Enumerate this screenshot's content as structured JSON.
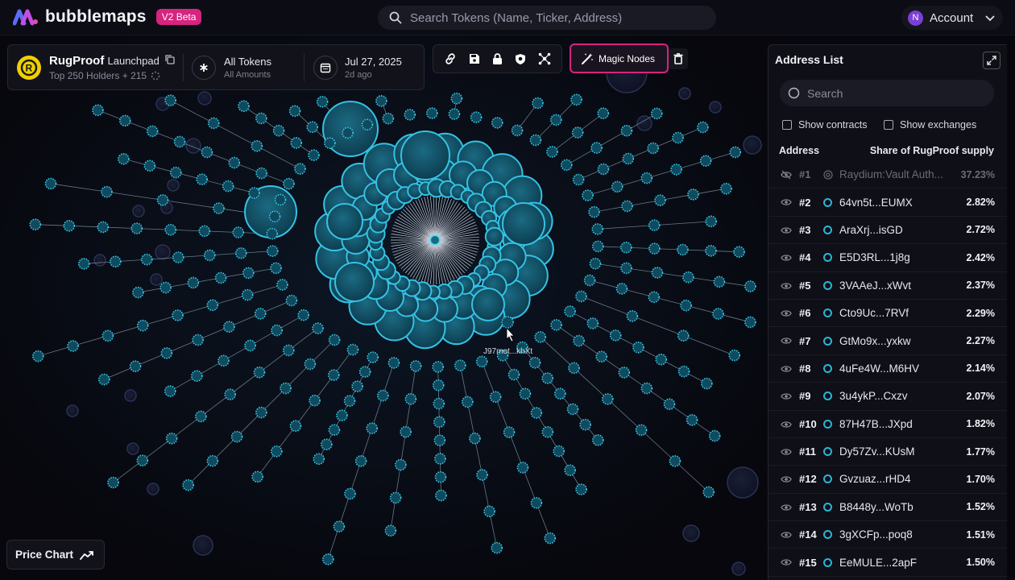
{
  "app": {
    "name": "bubblemaps",
    "badge": "V2 Beta"
  },
  "search": {
    "placeholder": "Search Tokens (Name, Ticker, Address)"
  },
  "account": {
    "initial": "N",
    "label": "Account"
  },
  "token": {
    "name": "RugProof",
    "platform": "Launchpad",
    "holders_text": "Top 250 Holders + 215",
    "filter_title": "All Tokens",
    "filter_sub": "All Amounts",
    "date": "Jul 27, 2025",
    "date_ago": "2d ago"
  },
  "toolbar": {
    "magic_label": "Magic Nodes"
  },
  "graph": {
    "hover_label": "J97mot...khXt"
  },
  "panel": {
    "title": "Address List",
    "search_placeholder": "Search",
    "show_contracts": "Show contracts",
    "show_exchanges": "Show exchanges",
    "col_address": "Address",
    "col_share": "Share of RugProof supply",
    "rows": [
      {
        "rank": "#1",
        "addr": "Raydium:Vault Auth...",
        "pct": "37.23%"
      },
      {
        "rank": "#2",
        "addr": "64vn5t...EUMX",
        "pct": "2.82%"
      },
      {
        "rank": "#3",
        "addr": "AraXrj...isGD",
        "pct": "2.72%"
      },
      {
        "rank": "#4",
        "addr": "E5D3RL...1j8g",
        "pct": "2.42%"
      },
      {
        "rank": "#5",
        "addr": "3VAAeJ...xWvt",
        "pct": "2.37%"
      },
      {
        "rank": "#6",
        "addr": "Cto9Uc...7RVf",
        "pct": "2.29%"
      },
      {
        "rank": "#7",
        "addr": "GtMo9x...yxkw",
        "pct": "2.27%"
      },
      {
        "rank": "#8",
        "addr": "4uFe4W...M6HV",
        "pct": "2.14%"
      },
      {
        "rank": "#9",
        "addr": "3u4ykP...Cxzv",
        "pct": "2.07%"
      },
      {
        "rank": "#10",
        "addr": "87H47B...JXpd",
        "pct": "1.82%"
      },
      {
        "rank": "#11",
        "addr": "Dy57Zv...KUsM",
        "pct": "1.77%"
      },
      {
        "rank": "#12",
        "addr": "Gvzuaz...rHD4",
        "pct": "1.70%"
      },
      {
        "rank": "#13",
        "addr": "B8448y...WoTb",
        "pct": "1.52%"
      },
      {
        "rank": "#14",
        "addr": "3gXCFp...poq8",
        "pct": "1.51%"
      },
      {
        "rank": "#15",
        "addr": "EeMULE...2apF",
        "pct": "1.50%"
      }
    ]
  },
  "price_chart": {
    "label": "Price Chart"
  },
  "colors": {
    "accent": "#d6247f",
    "bubble": "#29b6d8",
    "background": "#07070d"
  },
  "icons": [
    "bubblemaps-logo-icon",
    "search-icon",
    "chevron-down-icon",
    "copy-icon",
    "loading-icon",
    "asterisk-icon",
    "calendar-icon",
    "link-icon",
    "save-icon",
    "lock-icon",
    "shield-icon",
    "nodes-icon",
    "magic-wand-icon",
    "trash-icon",
    "expand-icon",
    "eye-icon",
    "eye-off-icon",
    "chart-line-icon"
  ]
}
